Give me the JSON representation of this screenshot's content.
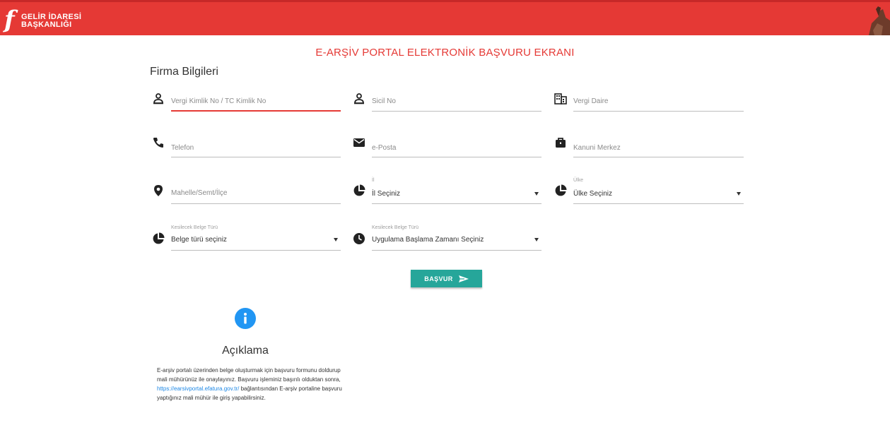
{
  "header": {
    "logo_line1": "GELİR İDARESİ",
    "logo_line2": "BAŞKANLIĞI",
    "bg_color": "#e53935"
  },
  "page_title": "E-ARŞİV PORTAL ELEKTRONİK BAŞVURU EKRANI",
  "section_title": "Firma Bilgileri",
  "fields": {
    "vkn": {
      "placeholder": "Vergi Kimlik No / TC Kimlik No",
      "icon": "person-icon"
    },
    "sicil": {
      "placeholder": "Sicil No",
      "icon": "person-icon"
    },
    "vergi_daire": {
      "placeholder": "Vergi Daire",
      "icon": "building-icon"
    },
    "telefon": {
      "placeholder": "Telefon",
      "icon": "phone-icon"
    },
    "eposta": {
      "placeholder": "e-Posta",
      "icon": "mail-icon"
    },
    "kanuni_merkez": {
      "placeholder": "Kanuni Merkez",
      "icon": "briefcase-icon"
    },
    "mahalle": {
      "placeholder": "Mahelle/Semt/İlçe",
      "icon": "location-pin-icon"
    },
    "il": {
      "label": "İl",
      "value": "İl Seçiniz",
      "icon": "pie-chart-icon"
    },
    "ulke": {
      "label": "Ülke",
      "value": "Ülke Seçiniz",
      "icon": "pie-chart-icon"
    },
    "belge_turu": {
      "label": "Kesilecek Belge Türü",
      "value": "Belge türü seçiniz",
      "icon": "pie-chart-icon"
    },
    "baslama_zamani": {
      "label": "Kesilecek Belge Türü",
      "value": "Uygulama Başlama Zamanı Seçiniz",
      "icon": "clock-icon"
    }
  },
  "submit_button": {
    "label": "BAŞVUR",
    "color": "#26a69a"
  },
  "info": {
    "title": "Açıklama",
    "text_before_link": "E-arşiv portalı üzerinden belge oluşturmak için başvuru formunu doldurup mali mühürünüz ile onaylayınız. Başvuru işleminiz başırılı olduktan sonra, ",
    "link": "https://earsivportal.efatura.gov.tr/",
    "text_after_link": " bağlantısından E-arşiv portaline başvuru yaptığınız mali mühür ile giriş yapabilirsiniz.",
    "icon_color": "#2196f3"
  }
}
